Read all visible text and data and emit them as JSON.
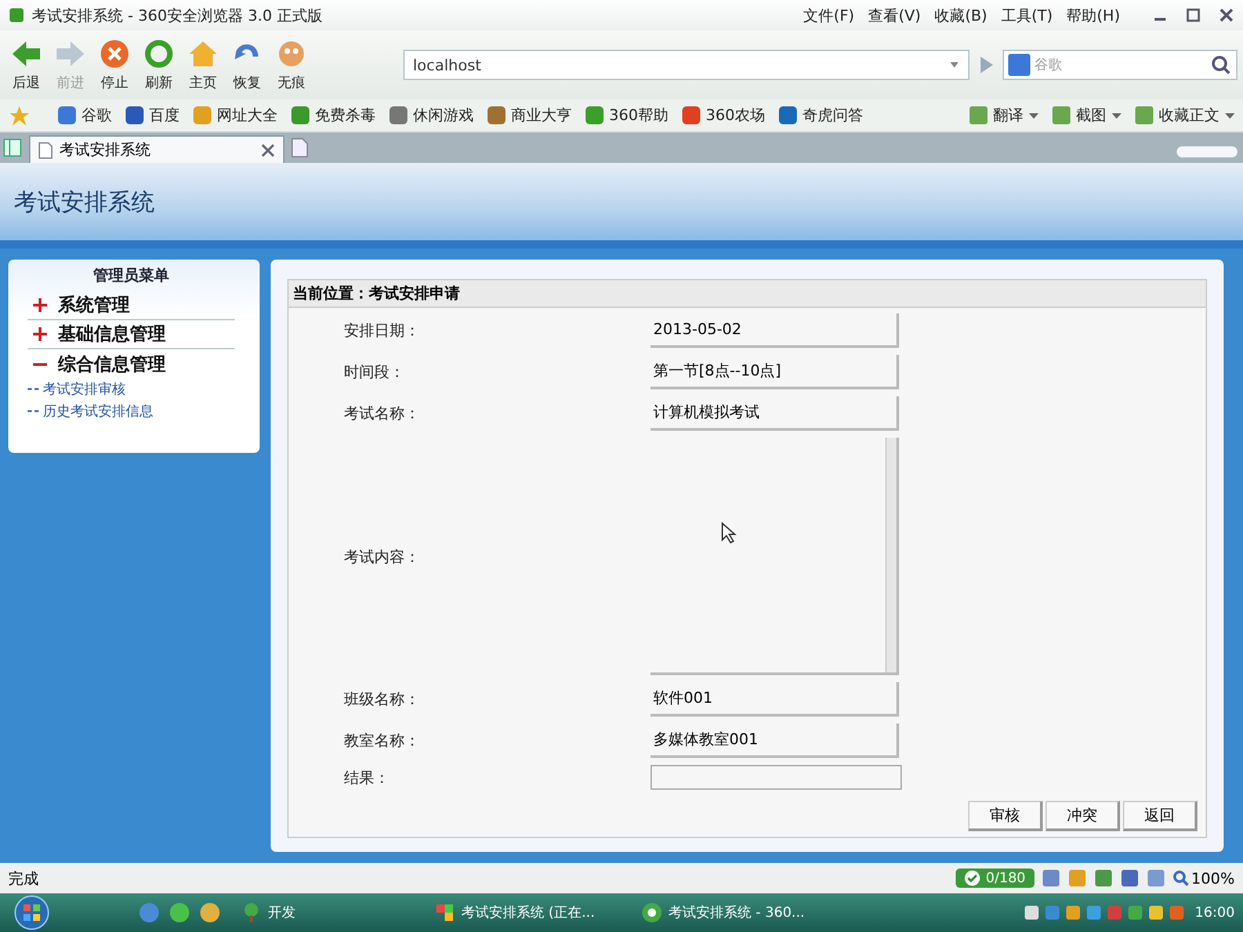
{
  "window": {
    "title": "考试安排系统 - 360安全浏览器 3.0 正式版"
  },
  "menu": [
    "文件(F)",
    "查看(V)",
    "收藏(B)",
    "工具(T)",
    "帮助(H)"
  ],
  "nav_buttons": [
    {
      "label": "后退",
      "kind": "back",
      "disabled": false
    },
    {
      "label": "前进",
      "kind": "forward",
      "disabled": true
    },
    {
      "label": "停止",
      "kind": "stop",
      "disabled": false
    },
    {
      "label": "刷新",
      "kind": "refresh",
      "disabled": false
    },
    {
      "label": "主页",
      "kind": "home",
      "disabled": false
    },
    {
      "label": "恢复",
      "kind": "restore",
      "disabled": false
    },
    {
      "label": "无痕",
      "kind": "private",
      "disabled": false
    }
  ],
  "address": {
    "value": "localhost"
  },
  "search": {
    "placeholder": "谷歌"
  },
  "bookmarks": [
    "谷歌",
    "百度",
    "网址大全",
    "免费杀毒",
    "休闲游戏",
    "商业大亨",
    "360帮助",
    "360农场",
    "奇虎问答"
  ],
  "bookmark_tools": [
    "翻译",
    "截图",
    "收藏正文"
  ],
  "tabs": [
    {
      "label": "考试安排系统",
      "selected": true
    }
  ],
  "page": {
    "header": "考试安排系统",
    "sidebar": {
      "title": "管理员菜单",
      "items": [
        {
          "label": "系统管理",
          "expanded": false
        },
        {
          "label": "基础信息管理",
          "expanded": false
        },
        {
          "label": "综合信息管理",
          "expanded": true,
          "children": [
            {
              "label": "考试安排审核"
            },
            {
              "label": "历史考试安排信息"
            }
          ]
        }
      ]
    },
    "breadcrumb": "当前位置：考试安排申请",
    "fields": [
      {
        "label": "安排日期：",
        "kind": "text",
        "value": "2013-05-02"
      },
      {
        "label": "时间段：",
        "kind": "text",
        "value": "第一节[8点--10点]"
      },
      {
        "label": "考试名称：",
        "kind": "text",
        "value": "计算机模拟考试"
      },
      {
        "label": "考试内容：",
        "kind": "textarea"
      },
      {
        "label": "班级名称：",
        "kind": "text",
        "value": "软件001"
      },
      {
        "label": "教室名称：",
        "kind": "text",
        "value": "多媒体教室001"
      },
      {
        "label": "结果：",
        "kind": "input"
      }
    ],
    "buttons": [
      "审核",
      "冲突",
      "返回"
    ]
  },
  "status_bar": {
    "text": "完成",
    "counter": "0/180",
    "zoom": "100%"
  },
  "taskbar": {
    "items": [
      {
        "label": "开发",
        "kind": "folder"
      },
      {
        "label": "考试安排系统 (正在...",
        "kind": "app"
      },
      {
        "label": "考试安排系统 - 360...",
        "kind": "browser"
      }
    ],
    "clock": "16:00"
  }
}
